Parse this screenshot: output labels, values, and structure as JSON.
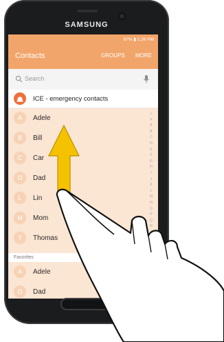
{
  "device": {
    "brand": "SAMSUNG"
  },
  "status_bar": {
    "text": "97% ▮ 1:26 PM"
  },
  "app_bar": {
    "title": "Contacts",
    "groups_label": "GROUPS",
    "more_label": "MORE"
  },
  "search": {
    "placeholder": "Search"
  },
  "ice_row": {
    "label": "ICE - emergency contacts"
  },
  "contacts": [
    {
      "initial": "A",
      "name": "Adele"
    },
    {
      "initial": "B",
      "name": "Bill"
    },
    {
      "initial": "C",
      "name": "Car"
    },
    {
      "initial": "D",
      "name": "Dad"
    },
    {
      "initial": "L",
      "name": "Lin"
    },
    {
      "initial": "M",
      "name": "Mom"
    },
    {
      "initial": "T",
      "name": "Thomas"
    }
  ],
  "index_letters": [
    "☺",
    "#",
    "A",
    "B",
    "C",
    "D",
    "E",
    "F",
    "G",
    "H",
    "I",
    "J",
    "K",
    "L",
    "M",
    "N",
    "O",
    "P",
    "Q",
    "R",
    "S",
    "T"
  ],
  "favorites": {
    "header": "Favorites",
    "items": [
      {
        "initial": "A",
        "name": "Adele"
      },
      {
        "initial": "D",
        "name": "Dad"
      }
    ]
  },
  "colors": {
    "accent": "#f2a56a",
    "list_bg": "#fbe5d3",
    "avatar": "#f7d2b5",
    "ice_badge": "#ef6f3a",
    "arrow": "#f5c200"
  },
  "icons": [
    "search-icon",
    "mic-icon",
    "ice-alarm-icon",
    "swipe-up-arrow-icon",
    "pointing-hand-icon"
  ]
}
